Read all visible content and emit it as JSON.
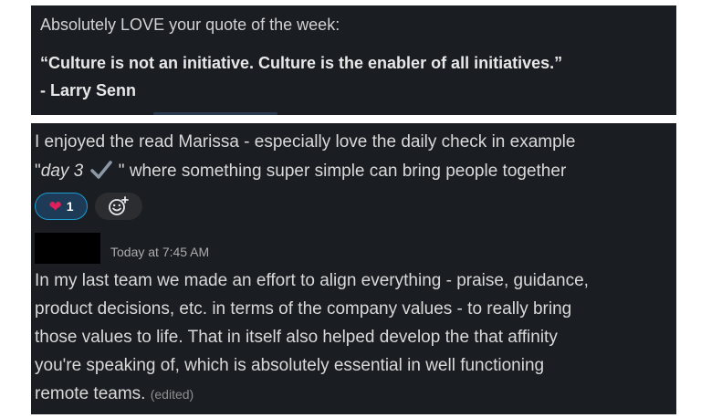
{
  "top_message": {
    "line1": "Absolutely LOVE your quote of the week:",
    "quote_line1": "“Culture is not an initiative. Culture is the enabler of all initiatives.”",
    "quote_line2": "- Larry Senn"
  },
  "reply_message": {
    "line1": "I enjoyed the read Marissa - especially love the daily check in example",
    "line2_prefix": "\"",
    "line2_italic": "day 3",
    "line2_suffix": " \" where something super simple can bring people together",
    "check_icon": "heavy-check-mark"
  },
  "reactions": [
    {
      "emoji": "❤️",
      "count": "1",
      "active": true
    }
  ],
  "add_reaction_icon": "smiley-plus-icon",
  "next_message": {
    "timestamp": "Today at 7:45 AM",
    "lines": [
      "In my last team we made an effort to align everything - praise, guidance,",
      "product decisions, etc. in terms of the company values - to really bring",
      "those values to life. That in itself also helped develop the that affinity",
      "you're speaking of, which is absolutely essential in well functioning",
      "remote teams."
    ],
    "edited_label": "(edited)"
  },
  "colors": {
    "panel": "#1a1d21",
    "text": "#d1d2d3",
    "reaction_bg": "#1d3a57",
    "reaction_border": "#1d9bd1",
    "heart": "#e01e5a"
  }
}
